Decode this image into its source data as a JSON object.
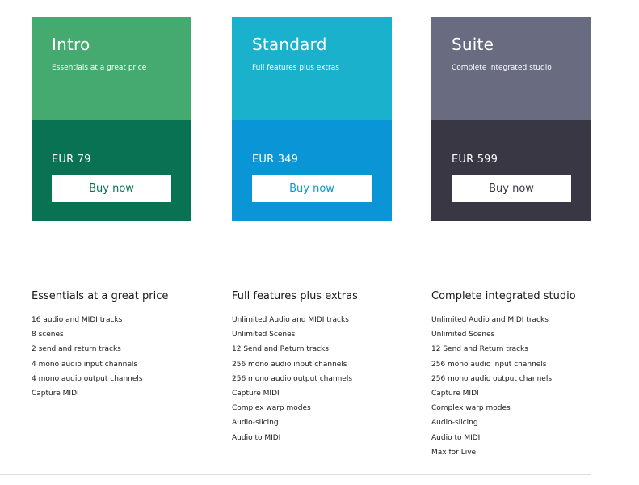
{
  "plans": [
    {
      "name": "Intro",
      "tagline": "Essentials at a great price",
      "price": "EUR 79",
      "button_label": "Buy now",
      "colors": {
        "top": "#45aa70",
        "bottom": "#087252",
        "button_text": "#087252"
      }
    },
    {
      "name": "Standard",
      "tagline": "Full features plus extras",
      "price": "EUR 349",
      "button_label": "Buy now",
      "colors": {
        "top": "#1ab1cd",
        "bottom": "#0a96d6",
        "button_text": "#0a96d6"
      }
    },
    {
      "name": "Suite",
      "tagline": "Complete integrated studio",
      "price": "EUR 599",
      "button_label": "Buy now",
      "colors": {
        "top": "#696c80",
        "bottom": "#393744",
        "button_text": "#393744"
      }
    }
  ],
  "features": [
    {
      "heading": "Essentials at a great price",
      "items": [
        "16 audio and MIDI tracks",
        "8 scenes",
        "2 send and return tracks",
        "4 mono audio input channels",
        "4 mono audio output channels",
        "Capture MIDI"
      ]
    },
    {
      "heading": "Full features plus extras",
      "items": [
        "Unlimited Audio and MIDI tracks",
        "Unlimited Scenes",
        "12 Send and Return tracks",
        "256 mono audio input channels",
        "256 mono audio output channels",
        "Capture MIDI",
        "Complex warp modes",
        "Audio-slicing",
        "Audio to MIDI"
      ]
    },
    {
      "heading": "Complete integrated studio",
      "items": [
        "Unlimited Audio and MIDI tracks",
        "Unlimited Scenes",
        "12 Send and Return tracks",
        "256 mono audio input channels",
        "256 mono audio output channels",
        "Capture MIDI",
        "Complex warp modes",
        "Audio-slicing",
        "Audio to MIDI",
        "Max for Live"
      ]
    }
  ]
}
